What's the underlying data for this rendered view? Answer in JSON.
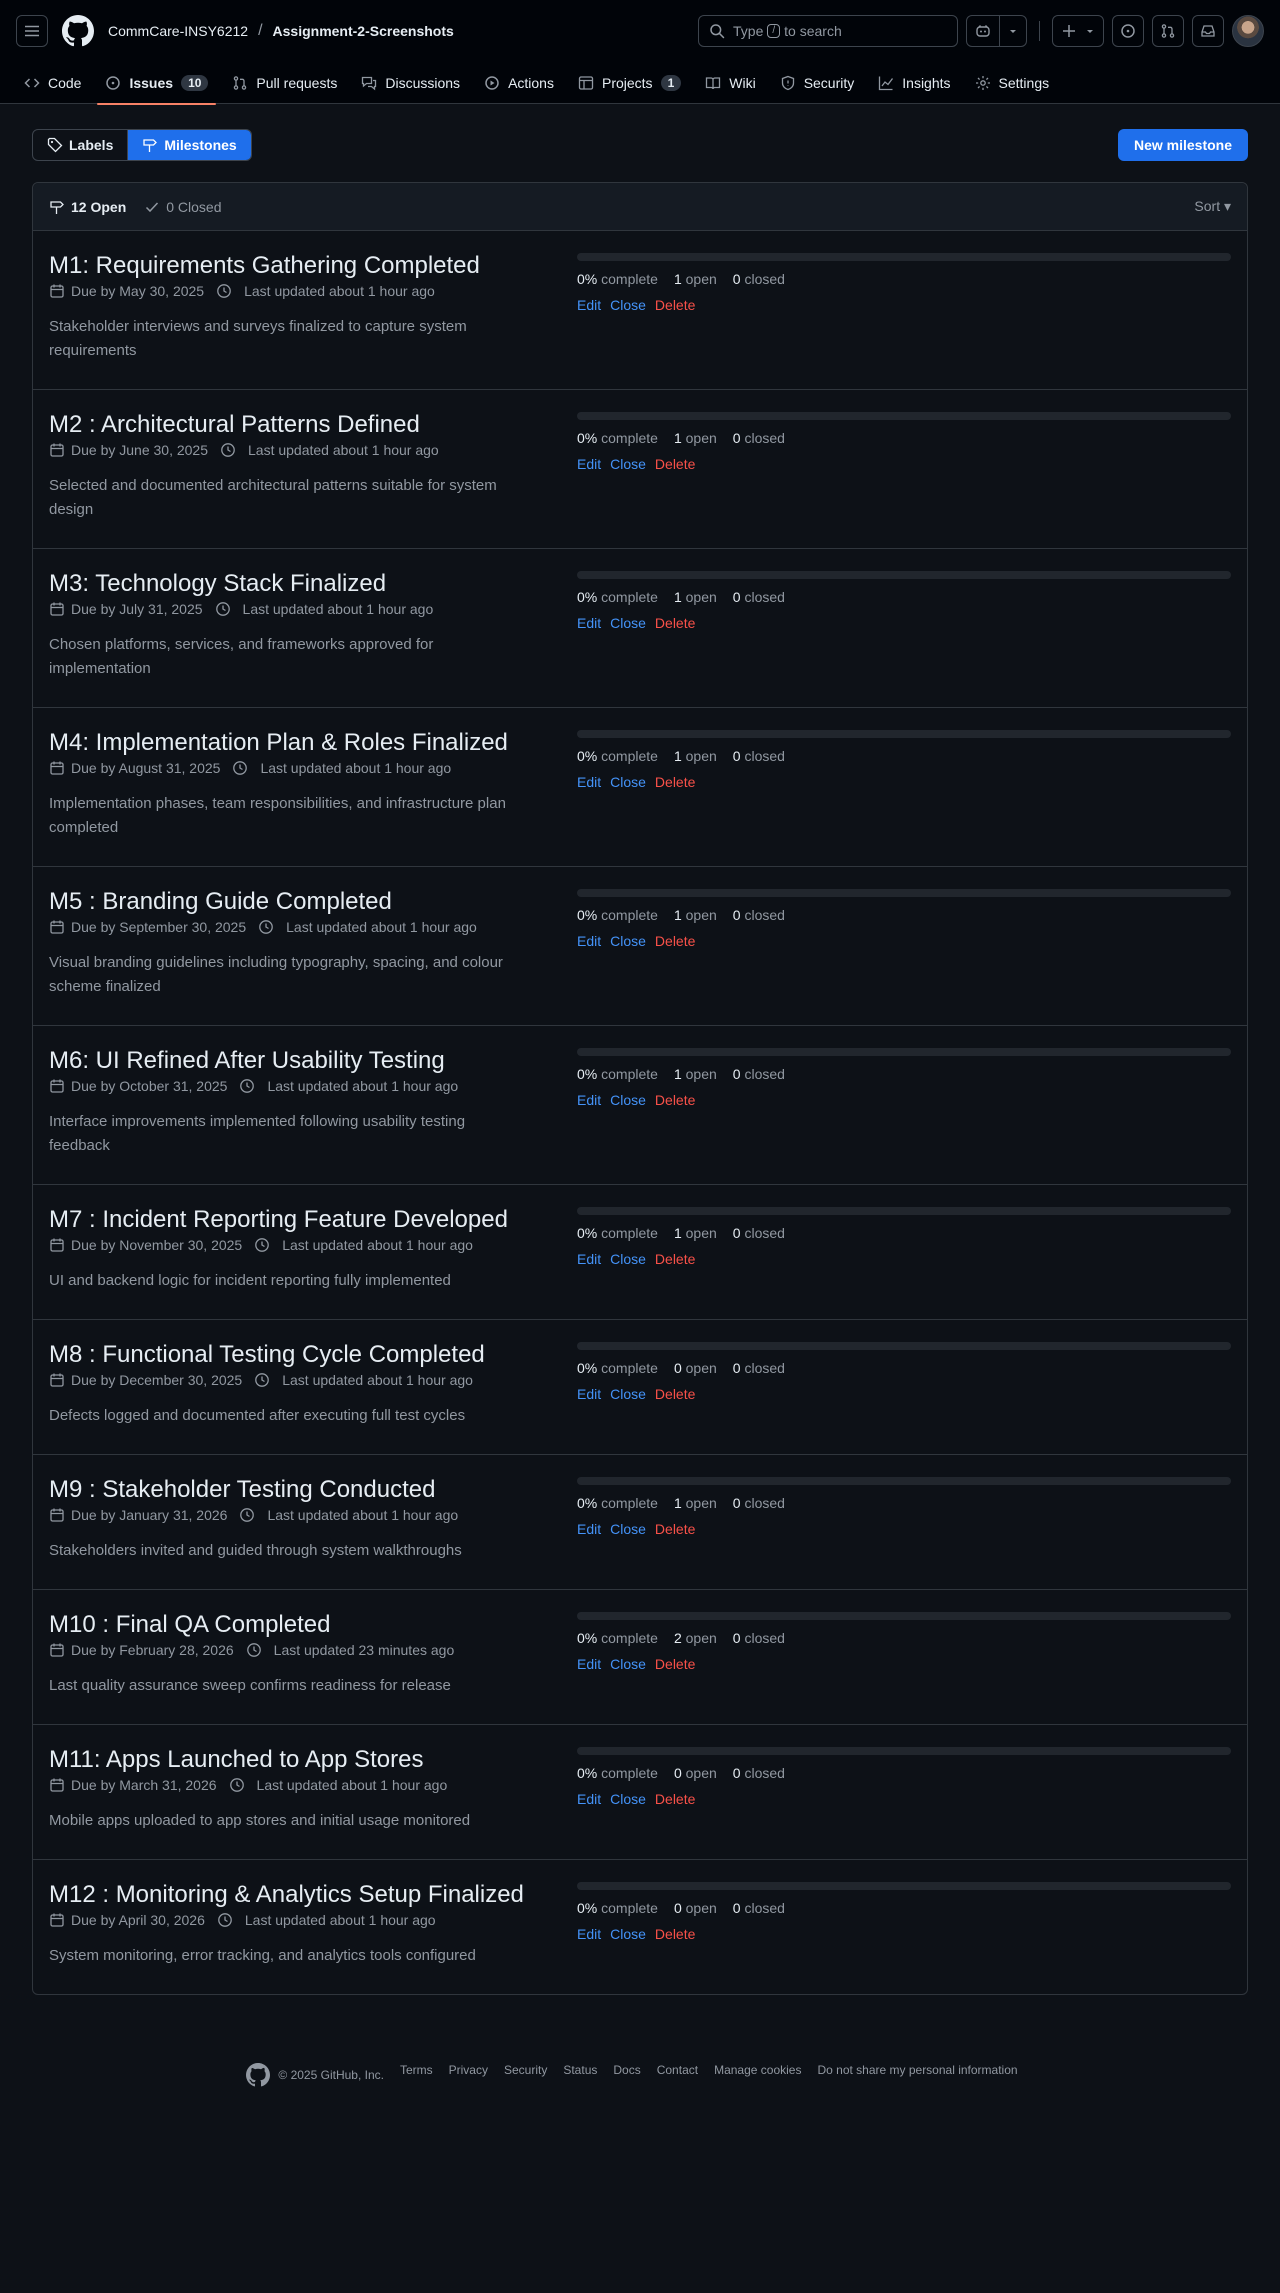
{
  "header": {
    "owner": "CommCare-INSY6212",
    "separator": "/",
    "repo": "Assignment-2-Screenshots",
    "search_prefix": "Type",
    "search_key": "/",
    "search_suffix": "to search"
  },
  "nav": [
    {
      "label": "Code",
      "icon": "code-icon",
      "active": false,
      "count": ""
    },
    {
      "label": "Issues",
      "icon": "issue-opened-icon",
      "active": true,
      "count": "10"
    },
    {
      "label": "Pull requests",
      "icon": "git-pull-request-icon",
      "active": false,
      "count": ""
    },
    {
      "label": "Discussions",
      "icon": "comment-discussion-icon",
      "active": false,
      "count": ""
    },
    {
      "label": "Actions",
      "icon": "play-icon",
      "active": false,
      "count": ""
    },
    {
      "label": "Projects",
      "icon": "table-icon",
      "active": false,
      "count": "1"
    },
    {
      "label": "Wiki",
      "icon": "book-icon",
      "active": false,
      "count": ""
    },
    {
      "label": "Security",
      "icon": "shield-icon",
      "active": false,
      "count": ""
    },
    {
      "label": "Insights",
      "icon": "graph-icon",
      "active": false,
      "count": ""
    },
    {
      "label": "Settings",
      "icon": "gear-icon",
      "active": false,
      "count": ""
    }
  ],
  "subnav": {
    "labels": "Labels",
    "milestones": "Milestones",
    "new_milestone": "New milestone"
  },
  "list": {
    "open_label": "12 Open",
    "closed_label": "0 Closed",
    "sort_label": "Sort ▾"
  },
  "milestones": [
    {
      "title": "M1: Requirements Gathering Completed",
      "due": "Due by May 30, 2025",
      "updated": "Last updated about 1 hour ago",
      "description": "Stakeholder interviews and surveys finalized to capture system requirements",
      "percent": "0%",
      "complete_label": "complete",
      "open_count": "1",
      "open_label": "open",
      "closed_count": "0",
      "closed_label": "closed",
      "progress": 0
    },
    {
      "title": "M2 : Architectural Patterns Defined",
      "due": "Due by June 30, 2025",
      "updated": "Last updated about 1 hour ago",
      "description": "Selected and documented architectural patterns suitable for system design",
      "percent": "0%",
      "complete_label": "complete",
      "open_count": "1",
      "open_label": "open",
      "closed_count": "0",
      "closed_label": "closed",
      "progress": 0
    },
    {
      "title": "M3: Technology Stack Finalized",
      "due": "Due by July 31, 2025",
      "updated": "Last updated about 1 hour ago",
      "description": "Chosen platforms, services, and frameworks approved for implementation",
      "percent": "0%",
      "complete_label": "complete",
      "open_count": "1",
      "open_label": "open",
      "closed_count": "0",
      "closed_label": "closed",
      "progress": 0
    },
    {
      "title": "M4: Implementation Plan & Roles Finalized",
      "due": "Due by August 31, 2025",
      "updated": "Last updated about 1 hour ago",
      "description": "Implementation phases, team responsibilities, and infrastructure plan completed",
      "percent": "0%",
      "complete_label": "complete",
      "open_count": "1",
      "open_label": "open",
      "closed_count": "0",
      "closed_label": "closed",
      "progress": 0
    },
    {
      "title": "M5 : Branding Guide Completed",
      "due": "Due by September 30, 2025",
      "updated": "Last updated about 1 hour ago",
      "description": "Visual branding guidelines including typography, spacing, and colour scheme finalized",
      "percent": "0%",
      "complete_label": "complete",
      "open_count": "1",
      "open_label": "open",
      "closed_count": "0",
      "closed_label": "closed",
      "progress": 0
    },
    {
      "title": "M6: UI Refined After Usability Testing",
      "due": "Due by October 31, 2025",
      "updated": "Last updated about 1 hour ago",
      "description": "Interface improvements implemented following usability testing feedback",
      "percent": "0%",
      "complete_label": "complete",
      "open_count": "1",
      "open_label": "open",
      "closed_count": "0",
      "closed_label": "closed",
      "progress": 0
    },
    {
      "title": "M7 : Incident Reporting Feature Developed",
      "due": "Due by November 30, 2025",
      "updated": "Last updated about 1 hour ago",
      "description": "UI and backend logic for incident reporting fully implemented",
      "percent": "0%",
      "complete_label": "complete",
      "open_count": "1",
      "open_label": "open",
      "closed_count": "0",
      "closed_label": "closed",
      "progress": 0
    },
    {
      "title": "M8 : Functional Testing Cycle Completed",
      "due": "Due by December 30, 2025",
      "updated": "Last updated about 1 hour ago",
      "description": "Defects logged and documented after executing full test cycles",
      "percent": "0%",
      "complete_label": "complete",
      "open_count": "0",
      "open_label": "open",
      "closed_count": "0",
      "closed_label": "closed",
      "progress": 0
    },
    {
      "title": "M9 : Stakeholder Testing Conducted",
      "due": "Due by January 31, 2026",
      "updated": "Last updated about 1 hour ago",
      "description": "Stakeholders invited and guided through system walkthroughs",
      "percent": "0%",
      "complete_label": "complete",
      "open_count": "1",
      "open_label": "open",
      "closed_count": "0",
      "closed_label": "closed",
      "progress": 0
    },
    {
      "title": "M10 : Final QA Completed",
      "due": "Due by February 28, 2026",
      "updated": "Last updated 23 minutes ago",
      "description": "Last quality assurance sweep confirms readiness for release",
      "percent": "0%",
      "complete_label": "complete",
      "open_count": "2",
      "open_label": "open",
      "closed_count": "0",
      "closed_label": "closed",
      "progress": 0
    },
    {
      "title": "M11: Apps Launched to App Stores",
      "due": "Due by March 31, 2026",
      "updated": "Last updated about 1 hour ago",
      "description": "Mobile apps uploaded to app stores and initial usage monitored",
      "percent": "0%",
      "complete_label": "complete",
      "open_count": "0",
      "open_label": "open",
      "closed_count": "0",
      "closed_label": "closed",
      "progress": 0
    },
    {
      "title": "M12 : Monitoring & Analytics Setup Finalized",
      "due": "Due by April 30, 2026",
      "updated": "Last updated about 1 hour ago",
      "description": "System monitoring, error tracking, and analytics tools configured",
      "percent": "0%",
      "complete_label": "complete",
      "open_count": "0",
      "open_label": "open",
      "closed_count": "0",
      "closed_label": "closed",
      "progress": 0
    }
  ],
  "actions": {
    "edit": "Edit",
    "close": "Close",
    "delete": "Delete"
  },
  "footer": {
    "copyright": "© 2025 GitHub, Inc.",
    "links": [
      "Terms",
      "Privacy",
      "Security",
      "Status",
      "Docs",
      "Contact",
      "Manage cookies",
      "Do not share my personal information"
    ]
  },
  "colors": {
    "background": "#0d1117",
    "header": "#010409",
    "accent": "#1f6feb",
    "link": "#4493f8",
    "danger": "#f85149",
    "tab_underline": "#f78166"
  }
}
